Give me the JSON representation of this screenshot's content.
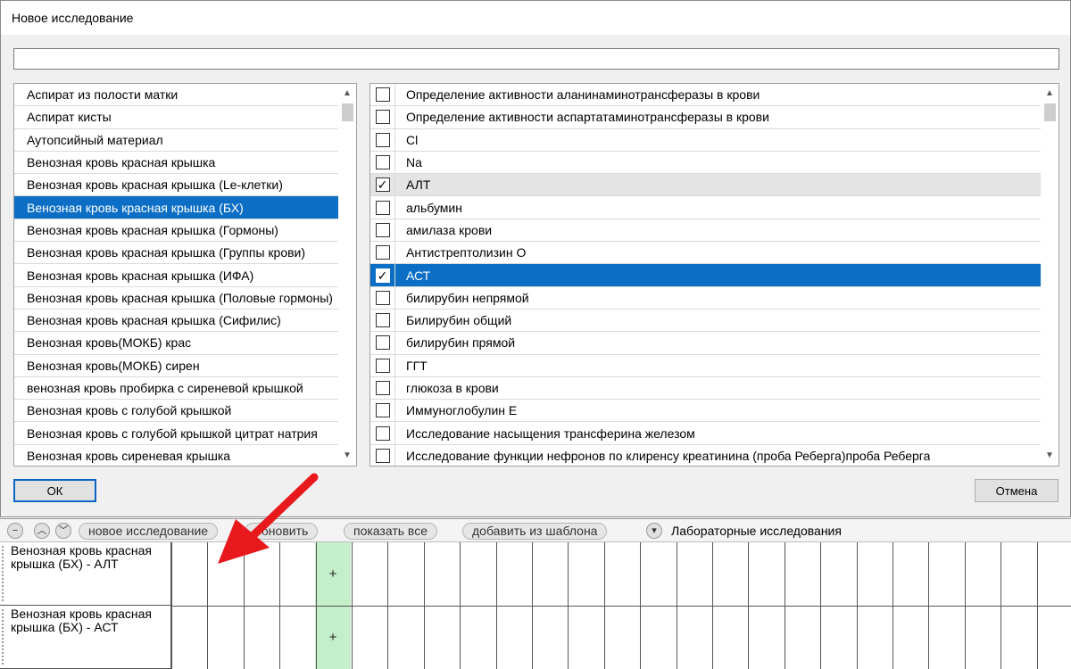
{
  "dialog": {
    "title": "Новое исследование",
    "search_value": "",
    "ok_label": "ОК",
    "cancel_label": "Отмена"
  },
  "materials": [
    {
      "label": "Аспират из полости матки",
      "selected": false
    },
    {
      "label": "Аспират кисты",
      "selected": false
    },
    {
      "label": "Аутопсийный материал",
      "selected": false
    },
    {
      "label": "Венозная кровь красная крышка",
      "selected": false
    },
    {
      "label": "Венозная кровь красная крышка (Le-клетки)",
      "selected": false
    },
    {
      "label": "Венозная кровь красная крышка (БХ)",
      "selected": true
    },
    {
      "label": "Венозная кровь красная крышка (Гормоны)",
      "selected": false
    },
    {
      "label": "Венозная кровь красная крышка (Группы крови)",
      "selected": false
    },
    {
      "label": "Венозная кровь красная крышка (ИФА)",
      "selected": false
    },
    {
      "label": "Венозная кровь красная крышка (Половые гормоны)",
      "selected": false
    },
    {
      "label": "Венозная кровь красная крышка (Сифилис)",
      "selected": false
    },
    {
      "label": "Венозная кровь(МОКБ) крас",
      "selected": false
    },
    {
      "label": "Венозная кровь(МОКБ) сирен",
      "selected": false
    },
    {
      "label": "венозная кровь пробирка  с сиреневой крышкой",
      "selected": false
    },
    {
      "label": "Венозная кровь с голубой крышкой",
      "selected": false
    },
    {
      "label": "Венозная кровь с голубой крышкой цитрат натрия",
      "selected": false
    },
    {
      "label": "Венозная кровь сиреневая крышка",
      "selected": false
    }
  ],
  "tests": [
    {
      "label": "Определение активности аланинаминотрансферазы в крови",
      "checked": false,
      "state": ""
    },
    {
      "label": "Определение активности аспартатаминотрансферазы в крови",
      "checked": false,
      "state": ""
    },
    {
      "label": "Cl",
      "checked": false,
      "state": ""
    },
    {
      "label": "Na",
      "checked": false,
      "state": ""
    },
    {
      "label": "АЛТ",
      "checked": true,
      "state": "grey"
    },
    {
      "label": "альбумин",
      "checked": false,
      "state": ""
    },
    {
      "label": "амилаза крови",
      "checked": false,
      "state": ""
    },
    {
      "label": "Антистрептолизин О",
      "checked": false,
      "state": ""
    },
    {
      "label": "АСТ",
      "checked": true,
      "state": "selected"
    },
    {
      "label": "билирубин непрямой",
      "checked": false,
      "state": ""
    },
    {
      "label": "Билирубин общий",
      "checked": false,
      "state": ""
    },
    {
      "label": "билирубин прямой",
      "checked": false,
      "state": ""
    },
    {
      "label": "ГГТ",
      "checked": false,
      "state": ""
    },
    {
      "label": "глюкоза в крови",
      "checked": false,
      "state": ""
    },
    {
      "label": "Иммуноглобулин Е",
      "checked": false,
      "state": ""
    },
    {
      "label": "Исследование насыщения трансферина железом",
      "checked": false,
      "state": ""
    },
    {
      "label": "Исследование функции нефронов по клиренсу креатинина (проба Реберга)проба Реберга",
      "checked": false,
      "state": ""
    }
  ],
  "toolbar": {
    "new_label": "новое исследование",
    "refresh_label": "обновить",
    "show_all_label": "показать все",
    "template_label": "добавить из шаблона",
    "section_label": "Лабораторные исследования"
  },
  "orders": [
    {
      "text": "Венозная кровь красная крышка (БХ) - АЛТ",
      "mark": "+"
    },
    {
      "text": "Венозная кровь красная крышка (БХ) - АСТ",
      "mark": "+"
    }
  ],
  "colors": {
    "selection": "#0c6fc5",
    "highlight_column": "#c4efc8",
    "arrow": "#e8191c"
  }
}
